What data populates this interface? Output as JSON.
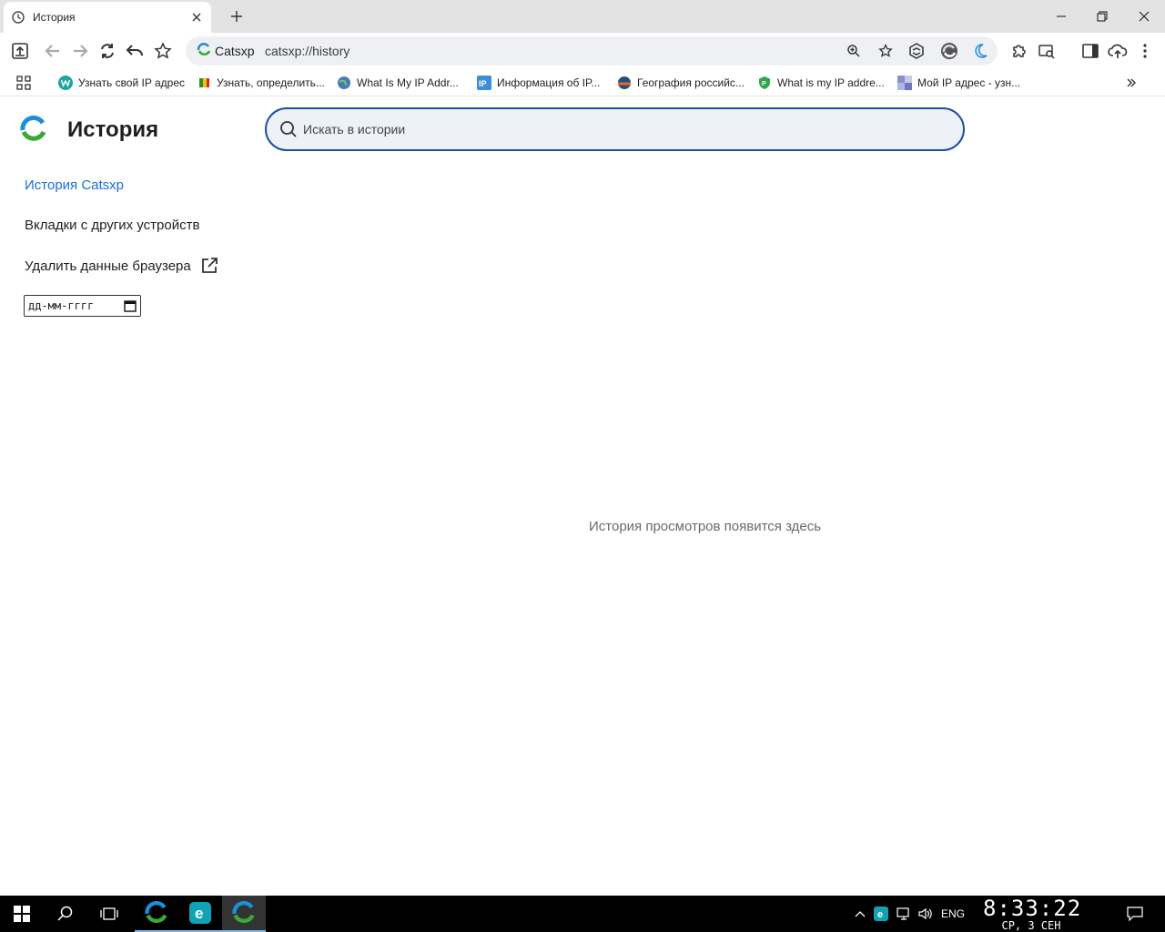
{
  "browser": {
    "tab_title": "История",
    "omnibox_chip": "Catsxp",
    "url": "catsxp://history",
    "bookmarks": [
      {
        "label": "Узнать свой IP адрес",
        "icon": "w-green-icon"
      },
      {
        "label": "Узнать, определить...",
        "icon": "flag-icon"
      },
      {
        "label": "What Is My IP Addr...",
        "icon": "globe-icon"
      },
      {
        "label": "Информация об IP...",
        "icon": "ip-icon"
      },
      {
        "label": "География российс...",
        "icon": "map-icon"
      },
      {
        "label": "What is my IP addre...",
        "icon": "shield-icon"
      },
      {
        "label": "Мой IP адрес - узн...",
        "icon": "pixel-icon"
      }
    ]
  },
  "page": {
    "title": "История",
    "search_placeholder": "Искать в истории",
    "nav": {
      "history": "История Catsxp",
      "other_devices": "Вкладки с других устройств",
      "clear_data": "Удалить данные браузера"
    },
    "date_placeholder": "дд-мм-гггг",
    "empty_message": "История просмотров появится здесь"
  },
  "taskbar": {
    "language": "ENG",
    "time": "8:33:22",
    "date": "СР, 3 СЕН"
  },
  "colors": {
    "accent": "#1a6fd6",
    "search_border": "#1a4fa0",
    "taskbar": "#000000"
  }
}
